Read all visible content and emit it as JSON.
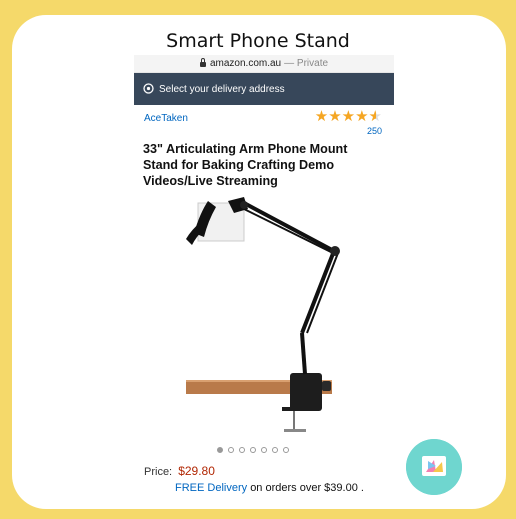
{
  "heading": "Smart Phone Stand",
  "browser": {
    "domain": "amazon.com.au",
    "separator": "—",
    "mode": "Private"
  },
  "delivery": {
    "label": "Select your delivery address",
    "icon": "location-pin-icon"
  },
  "product": {
    "brand": "AceTaken",
    "rating_stars": 4.5,
    "rating_count": "250",
    "title": "33\" Articulating Arm Phone Mount Stand for Baking Crafting Demo Videos/Live Streaming",
    "image_count": 7,
    "active_image": 1,
    "price_label": "Price:",
    "price": "$29.80",
    "free_delivery": "FREE Delivery",
    "delivery_terms": "on orders over $39.00 ."
  },
  "colors": {
    "background": "#f5d96a",
    "nav_bar": "#37475a",
    "link": "#0066c0",
    "price": "#b12704",
    "star": "#f5a623",
    "logo": "#6fd6cf"
  }
}
